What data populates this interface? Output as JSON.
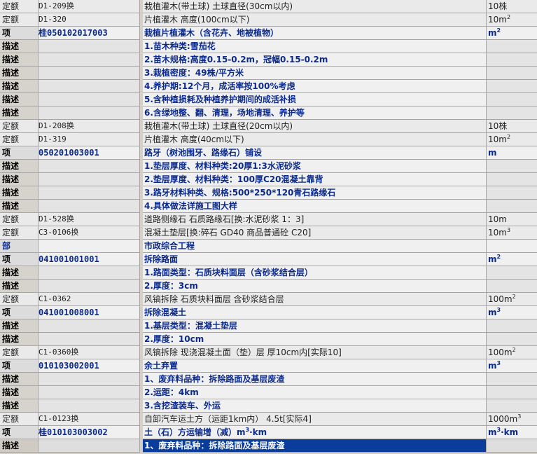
{
  "rows": [
    {
      "type": "定额",
      "code": "D1-209换",
      "name": "栽植灌木(带土球) 土球直径(30cm以内)",
      "unit": "10株",
      "kind": "quota"
    },
    {
      "type": "定额",
      "code": "D1-320",
      "name": "片植灌木 高度(100cm以下)",
      "unit": "10m²",
      "kind": "quota"
    },
    {
      "type": "项",
      "code": "桂050102017003",
      "name": "栽植片植灌木（含花卉、地被植物）",
      "unit": "m²",
      "kind": "item"
    },
    {
      "type": "描述",
      "code": "",
      "name": "1.苗木种类:雪茄花",
      "unit": "",
      "kind": "desc"
    },
    {
      "type": "描述",
      "code": "",
      "name": "2.苗木规格:高度0.15-0.2m，冠幅0.15-0.2m",
      "unit": "",
      "kind": "desc"
    },
    {
      "type": "描述",
      "code": "",
      "name": "3.栽植密度：49株/平方米",
      "unit": "",
      "kind": "desc"
    },
    {
      "type": "描述",
      "code": "",
      "name": "4.养护期:12个月，成活率按100%考虑",
      "unit": "",
      "kind": "desc"
    },
    {
      "type": "描述",
      "code": "",
      "name": "5.含种植损耗及种植养护期间的成活补损",
      "unit": "",
      "kind": "desc"
    },
    {
      "type": "描述",
      "code": "",
      "name": "6.含绿地整、翻、清理，场地清理、养护等",
      "unit": "",
      "kind": "desc"
    },
    {
      "type": "定额",
      "code": "D1-208换",
      "name": "栽植灌木(带土球) 土球直径(20cm以内)",
      "unit": "10株",
      "kind": "quota"
    },
    {
      "type": "定额",
      "code": "D1-319",
      "name": "片植灌木 高度(40cm以下)",
      "unit": "10m²",
      "kind": "quota"
    },
    {
      "type": "项",
      "code": "050201003001",
      "name": "路牙（树池围牙、路缘石）铺设",
      "unit": "m",
      "kind": "item"
    },
    {
      "type": "描述",
      "code": "",
      "name": "1.垫层厚度、材料种类:20厚1:3水泥砂浆",
      "unit": "",
      "kind": "desc"
    },
    {
      "type": "描述",
      "code": "",
      "name": "2.垫层厚度、材料种类：100厚C20混凝土靠背",
      "unit": "",
      "kind": "desc"
    },
    {
      "type": "描述",
      "code": "",
      "name": "3.路牙材料种类、规格:500*250*120青石路缘石",
      "unit": "",
      "kind": "desc"
    },
    {
      "type": "描述",
      "code": "",
      "name": "4.具体做法详施工图大样",
      "unit": "",
      "kind": "desc"
    },
    {
      "type": "定额",
      "code": "D1-528换",
      "name": "道路侧缘石 石质路缘石[换:水泥砂浆 1：3]",
      "unit": "10m",
      "kind": "quota"
    },
    {
      "type": "定额",
      "code": "C3-0106换",
      "name": "混凝土垫层[换:碎石 GD40  商品普通砼  C20]",
      "unit": "10m³",
      "kind": "quota"
    },
    {
      "type": "部",
      "code": "",
      "name": "市政综合工程",
      "unit": "",
      "kind": "part"
    },
    {
      "type": "项",
      "code": "041001001001",
      "name": "拆除路面",
      "unit": "m²",
      "kind": "item"
    },
    {
      "type": "描述",
      "code": "",
      "name": "1.路面类型：石质块料面层（含砂浆结合层）",
      "unit": "",
      "kind": "desc"
    },
    {
      "type": "描述",
      "code": "",
      "name": "2.厚度：3cm",
      "unit": "",
      "kind": "desc"
    },
    {
      "type": "定额",
      "code": "C1-0362",
      "name": "风镐拆除 石质块料面层 含砂浆结合层",
      "unit": "100m²",
      "kind": "quota"
    },
    {
      "type": "项",
      "code": "041001008001",
      "name": "拆除混凝土",
      "unit": "m³",
      "kind": "item"
    },
    {
      "type": "描述",
      "code": "",
      "name": "1.基层类型：混凝土垫层",
      "unit": "",
      "kind": "desc"
    },
    {
      "type": "描述",
      "code": "",
      "name": "2.厚度：10cm",
      "unit": "",
      "kind": "desc"
    },
    {
      "type": "定额",
      "code": "C1-0360换",
      "name": "风镐拆除 现浇混凝土面（垫）层 厚10cm内[实际10]",
      "unit": "100m²",
      "kind": "quota"
    },
    {
      "type": "项",
      "code": "010103002001",
      "name": "余土弃置",
      "unit": "m³",
      "kind": "item"
    },
    {
      "type": "描述",
      "code": "",
      "name": "1、废弃料品种：拆除路面及基层废渣",
      "unit": "",
      "kind": "desc"
    },
    {
      "type": "描述",
      "code": "",
      "name": "2.运距：4km",
      "unit": "",
      "kind": "desc"
    },
    {
      "type": "描述",
      "code": "",
      "name": "3.含挖渣装车、外运",
      "unit": "",
      "kind": "desc"
    },
    {
      "type": "定额",
      "code": "C1-0123换",
      "name": "自卸汽车运土方（运距1km内） 4.5t[实际4]",
      "unit": "1000m³",
      "kind": "quota"
    },
    {
      "type": "项",
      "code": "桂010103003002",
      "name": "土（石）方运输增（减）m³·km",
      "unit": "m³·km",
      "kind": "item"
    },
    {
      "type": "描述",
      "code": "",
      "name": "1、废弃料品种：拆除路面及基层废渣",
      "unit": "",
      "kind": "desc",
      "selected": true
    }
  ]
}
